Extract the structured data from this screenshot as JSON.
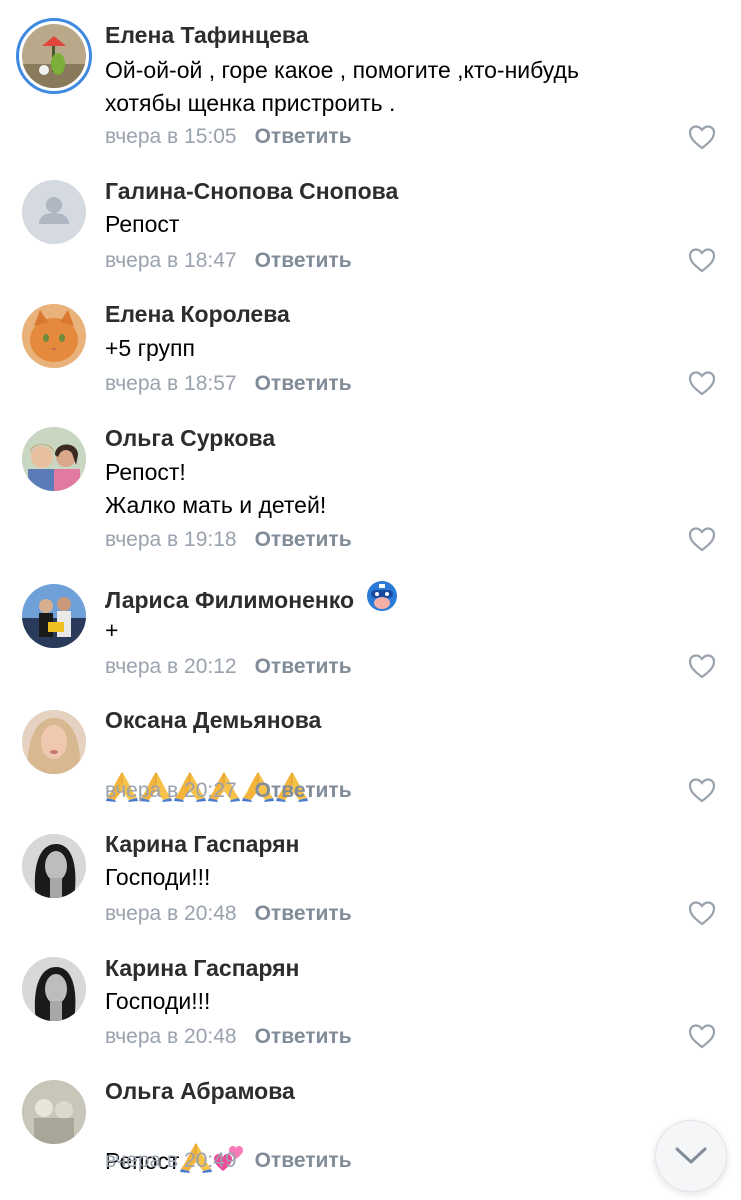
{
  "comments": [
    {
      "author": "Елена Тафинцева",
      "text": "Ой-ой-ой , горе какое , помогите ,кто-нибудь\nхотябы щенка пристроить .",
      "time": "вчера в 15:05",
      "reply": "Ответить"
    },
    {
      "author": "Галина-Снопова Снопова",
      "text": "Репост",
      "time": "вчера в 18:47",
      "reply": "Ответить"
    },
    {
      "author": "Елена Королева",
      "text": "+5 групп",
      "time": "вчера в 18:57",
      "reply": "Ответить"
    },
    {
      "author": "Ольга Суркова",
      "text": "Репост!\nЖалко мать и детей!",
      "time": "вчера в 19:18",
      "reply": "Ответить"
    },
    {
      "author": "Лариса Филимоненко",
      "text": "+",
      "time": "вчера в 20:12",
      "reply": "Ответить"
    },
    {
      "author": "Оксана Демьянова",
      "text": "",
      "time": "вчера в 20:27",
      "reply": "Ответить"
    },
    {
      "author": "Карина Гаспарян",
      "text": "Господи!!!",
      "time": "вчера в 20:48",
      "reply": "Ответить"
    },
    {
      "author": "Карина Гаспарян",
      "text": "Господи!!!",
      "time": "вчера в 20:48",
      "reply": "Ответить"
    },
    {
      "author": "Ольга Абрамова",
      "text": "Репост",
      "time": "вчера в 20:49",
      "reply": "Ответить"
    }
  ],
  "icons": {
    "like": "heart-outline-icon",
    "scroll": "chevron-down-icon",
    "pray": "folded-hands-emoji",
    "hearts": "two-hearts-emoji",
    "badge": "superhero-mask-badge"
  },
  "colors": {
    "name": "#2c2d2e",
    "meta": "#99a2ad",
    "reply": "#818c99",
    "story_ring": "#3f8ae0"
  }
}
